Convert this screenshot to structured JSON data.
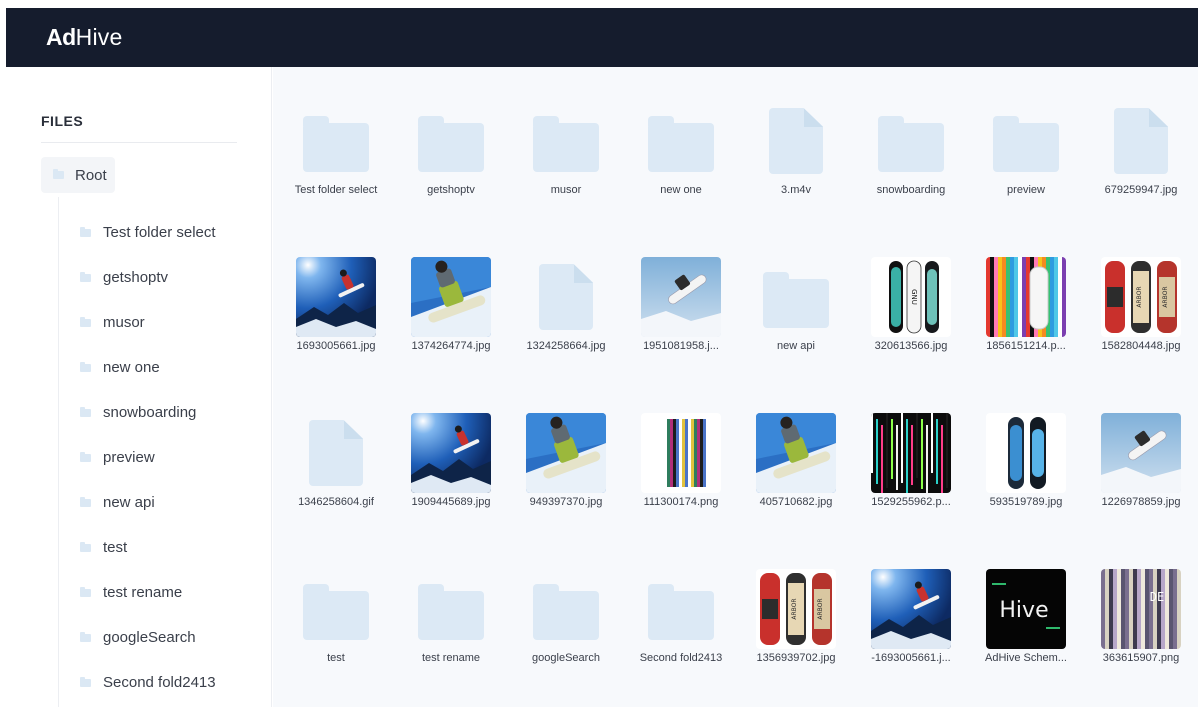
{
  "header": {
    "logo_bold": "Ad",
    "logo_thin": "Hive"
  },
  "sidebar": {
    "title": "FILES",
    "root_label": "Root",
    "items": [
      {
        "label": "Test folder select"
      },
      {
        "label": "getshoptv"
      },
      {
        "label": "musor"
      },
      {
        "label": "new one"
      },
      {
        "label": "snowboarding"
      },
      {
        "label": "preview"
      },
      {
        "label": "new api"
      },
      {
        "label": "test"
      },
      {
        "label": "test rename"
      },
      {
        "label": "googleSearch"
      },
      {
        "label": "Second fold2413"
      }
    ]
  },
  "grid": {
    "items": [
      {
        "name": "Test folder select",
        "type": "folder"
      },
      {
        "name": "getshoptv",
        "type": "folder"
      },
      {
        "name": "musor",
        "type": "folder"
      },
      {
        "name": "new one",
        "type": "folder"
      },
      {
        "name": "3.m4v",
        "type": "file"
      },
      {
        "name": "snowboarding",
        "type": "folder"
      },
      {
        "name": "preview",
        "type": "folder"
      },
      {
        "name": "679259947.jpg",
        "type": "file"
      },
      {
        "name": "1693005661.jpg",
        "type": "image",
        "preview": "snowboarder-air"
      },
      {
        "name": "1374264774.jpg",
        "type": "image",
        "preview": "snowboarder-closeup"
      },
      {
        "name": "1324258664.jpg",
        "type": "file"
      },
      {
        "name": "1951081958.j...",
        "type": "image",
        "preview": "snowboard-sky"
      },
      {
        "name": "new api",
        "type": "folder"
      },
      {
        "name": "320613566.jpg",
        "type": "image",
        "preview": "boards-gnu"
      },
      {
        "name": "1856151214.p...",
        "type": "image",
        "preview": "glitch-stripes"
      },
      {
        "name": "1582804448.jpg",
        "type": "image",
        "preview": "boards-arbor"
      },
      {
        "name": "1346258604.gif",
        "type": "file"
      },
      {
        "name": "1909445689.jpg",
        "type": "image",
        "preview": "snowboarder-air"
      },
      {
        "name": "949397370.jpg",
        "type": "image",
        "preview": "snowboarder-closeup"
      },
      {
        "name": "111300174.png",
        "type": "image",
        "preview": "boards-pattern"
      },
      {
        "name": "405710682.jpg",
        "type": "image",
        "preview": "snowboarder-closeup"
      },
      {
        "name": "1529255962.p...",
        "type": "image",
        "preview": "glitch-dark"
      },
      {
        "name": "593519789.jpg",
        "type": "image",
        "preview": "boards-blue"
      },
      {
        "name": "1226978859.jpg",
        "type": "image",
        "preview": "snowboard-sky"
      },
      {
        "name": "test",
        "type": "folder"
      },
      {
        "name": "test rename",
        "type": "folder"
      },
      {
        "name": "googleSearch",
        "type": "folder"
      },
      {
        "name": "Second fold2413",
        "type": "folder"
      },
      {
        "name": "1356939702.jpg",
        "type": "image",
        "preview": "boards-arbor"
      },
      {
        "name": "-1693005661.j...",
        "type": "image",
        "preview": "snowboarder-air"
      },
      {
        "name": "AdHive Schem...",
        "type": "image",
        "preview": "hive-logo",
        "preview_text": "Hive"
      },
      {
        "name": "363615907.png",
        "type": "image",
        "preview": "glitch-letters",
        "preview_text": "DE"
      }
    ]
  }
}
